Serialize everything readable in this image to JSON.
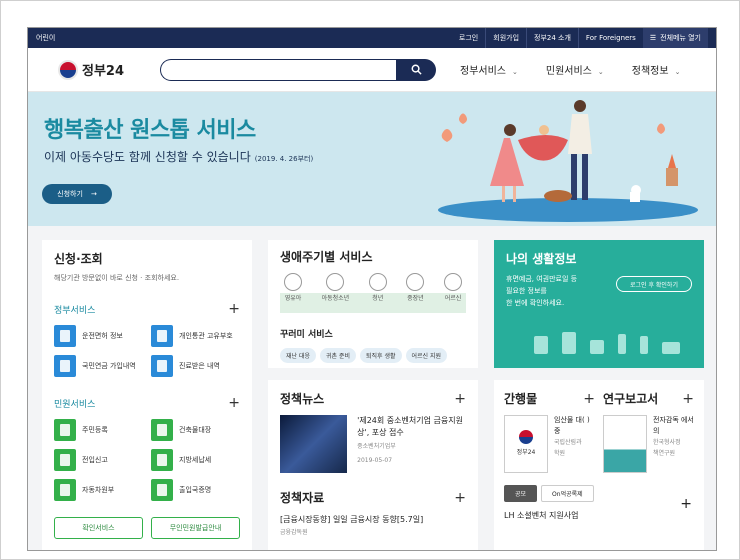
{
  "topbar": {
    "left": "어린이",
    "links": [
      "로그인",
      "회원가입",
      "정부24 소개",
      "For Foreigners"
    ],
    "allmenu": "전체메뉴 열기"
  },
  "header": {
    "logo": "정부24",
    "nav": [
      "정부서비스",
      "민원서비스",
      "정책정보"
    ]
  },
  "banner": {
    "title": "행복출산 원스톱 서비스",
    "subtitle": "이제 아동수당도 함께 신청할 수 있습니다",
    "date": "(2019. 4. 26부터)",
    "apply": "신청하기"
  },
  "apply_panel": {
    "title": "신청·조회",
    "desc": "해당기관 방문없이 바로 신청 · 조회하세요.",
    "gov_title": "정부서비스",
    "gov_items": [
      "운전면허 정보",
      "개인통관 고유부호",
      "국민연금 가입내역",
      "진료받은 내역"
    ],
    "civil_title": "민원서비스",
    "civil_items": [
      "주민등록",
      "건축물대장",
      "전입신고",
      "지방세납세",
      "자동차원부",
      "출입국증명"
    ],
    "btn1": "확인서비스",
    "btn2": "무인민원발급안내"
  },
  "life": {
    "title": "생애주기별 서비스",
    "faces": [
      "영유아",
      "아동청소년",
      "청년",
      "중장년",
      "어르신"
    ],
    "bundle_title": "꾸러미 서비스",
    "chips": [
      "재난 대응",
      "귀촌 준비",
      "퇴직후 생활",
      "어르신 지원"
    ]
  },
  "mylife": {
    "title": "나의 생활정보",
    "desc": [
      "휴면예금, 여권만료일 등",
      "필요한 정보를",
      "한 번에 확인하세요."
    ],
    "login": "로그인 후 확인하기"
  },
  "news": {
    "title": "정책뉴스",
    "headline": "'제24회 중소벤처기업 금융지원상', 포상 접수",
    "org": "중소벤처기업부",
    "date": "2019-05-07",
    "data_title": "정책자료",
    "data_item": "[금융시장동향] 일일 금융시장 동향[5.7일]",
    "data_org": "금융감독원"
  },
  "pubs": {
    "title1": "간행물",
    "title2": "연구보고서",
    "book1_cover": "정부24",
    "book1_title": "임산물 대( )중",
    "book1_org1": "국립산림과",
    "book1_org2": "학원",
    "book2_title": "전자감독 에서의",
    "book2_org1": "한국형사정",
    "book2_org2": "책연구원",
    "tab_on": "공모",
    "tab_off": "On억공록제",
    "last": "LH 소셜벤처 지원사업"
  }
}
